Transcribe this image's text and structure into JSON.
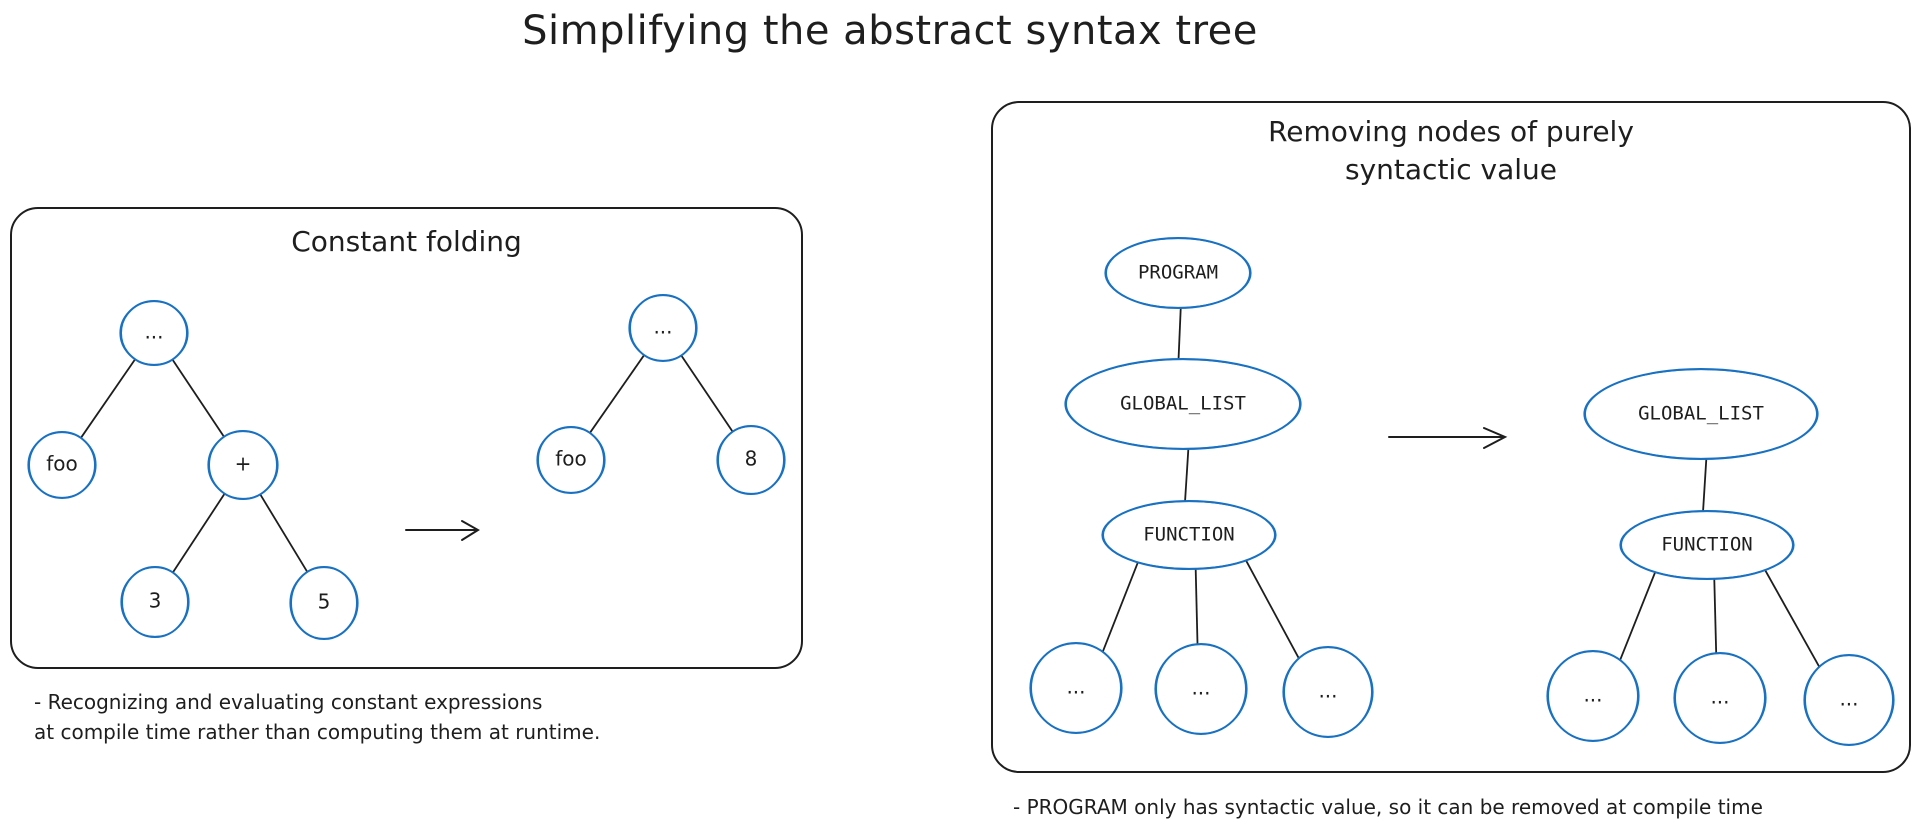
{
  "title": "Simplifying the abstract syntax tree",
  "colors": {
    "node_stroke": "#1971c2",
    "ink": "#1e1e1e",
    "background": "#ffffff"
  },
  "panels": [
    {
      "id": "constant-folding",
      "title": "Constant folding",
      "note_lines": [
        "- Recognizing and evaluating constant expressions",
        "at compile time rather than computing them at runtime."
      ],
      "before": {
        "nodes": [
          {
            "id": "root",
            "label": "..."
          },
          {
            "id": "foo",
            "label": "foo"
          },
          {
            "id": "plus",
            "label": "+"
          },
          {
            "id": "three",
            "label": "3"
          },
          {
            "id": "five",
            "label": "5"
          }
        ],
        "edges": [
          [
            "root",
            "foo"
          ],
          [
            "root",
            "plus"
          ],
          [
            "plus",
            "three"
          ],
          [
            "plus",
            "five"
          ]
        ]
      },
      "after": {
        "nodes": [
          {
            "id": "root",
            "label": "..."
          },
          {
            "id": "foo",
            "label": "foo"
          },
          {
            "id": "eight",
            "label": "8"
          }
        ],
        "edges": [
          [
            "root",
            "foo"
          ],
          [
            "root",
            "eight"
          ]
        ]
      }
    },
    {
      "id": "remove-syntactic",
      "title_lines": [
        "Removing nodes of purely",
        "syntactic value"
      ],
      "note": "- PROGRAM only has syntactic value, so it can be removed at compile time",
      "before": {
        "nodes": [
          {
            "id": "program",
            "label": "PROGRAM"
          },
          {
            "id": "global",
            "label": "GLOBAL_LIST"
          },
          {
            "id": "function",
            "label": "FUNCTION"
          },
          {
            "id": "c1",
            "label": "..."
          },
          {
            "id": "c2",
            "label": "..."
          },
          {
            "id": "c3",
            "label": "..."
          }
        ],
        "edges": [
          [
            "program",
            "global"
          ],
          [
            "global",
            "function"
          ],
          [
            "function",
            "c1"
          ],
          [
            "function",
            "c2"
          ],
          [
            "function",
            "c3"
          ]
        ]
      },
      "after": {
        "nodes": [
          {
            "id": "global",
            "label": "GLOBAL_LIST"
          },
          {
            "id": "function",
            "label": "FUNCTION"
          },
          {
            "id": "c1",
            "label": "..."
          },
          {
            "id": "c2",
            "label": "..."
          },
          {
            "id": "c3",
            "label": "..."
          }
        ],
        "edges": [
          [
            "global",
            "function"
          ],
          [
            "function",
            "c1"
          ],
          [
            "function",
            "c2"
          ],
          [
            "function",
            "c3"
          ]
        ]
      }
    }
  ]
}
